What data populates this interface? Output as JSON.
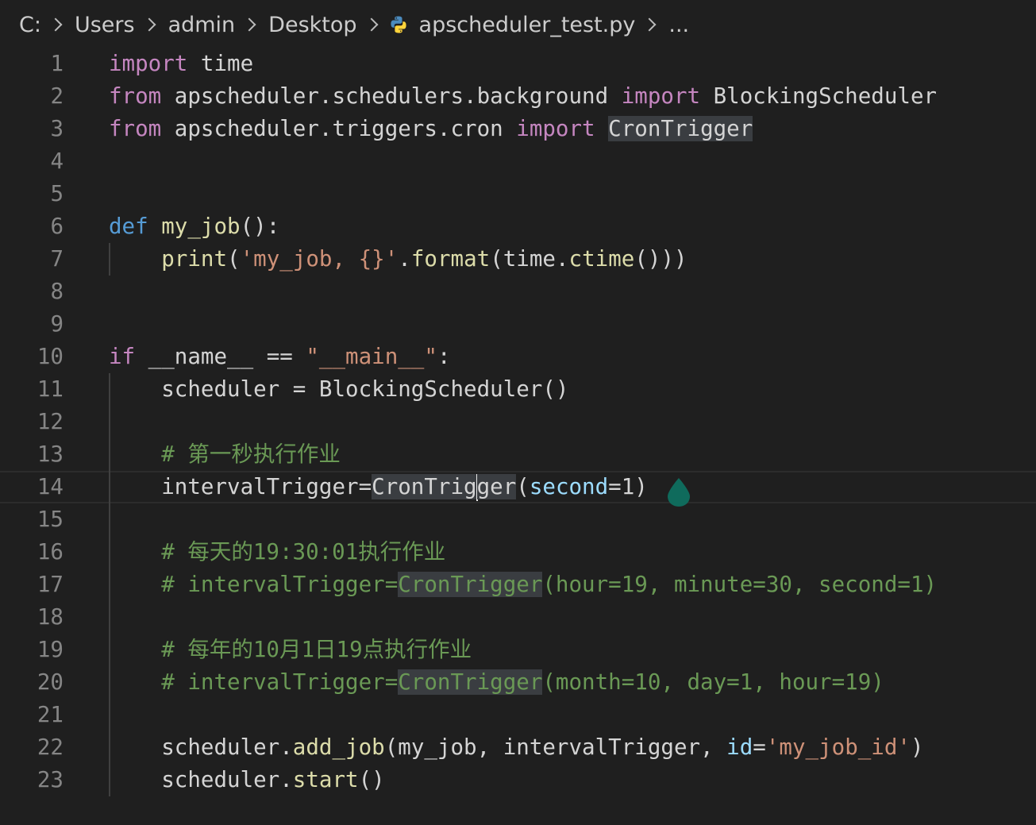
{
  "breadcrumb": {
    "items": [
      "C:",
      "Users",
      "admin",
      "Desktop",
      "apscheduler_test.py",
      "..."
    ]
  },
  "editor": {
    "language": "python",
    "file_icon": "python-file-icon",
    "current_line": 14,
    "lines": [
      {
        "num": "1",
        "tokens": [
          {
            "t": "import",
            "c": "kw-import"
          },
          {
            "t": " time",
            "c": ""
          }
        ]
      },
      {
        "num": "2",
        "tokens": [
          {
            "t": "from",
            "c": "kw-import"
          },
          {
            "t": " apscheduler.schedulers.background ",
            "c": ""
          },
          {
            "t": "import",
            "c": "kw-import"
          },
          {
            "t": " BlockingScheduler",
            "c": ""
          }
        ]
      },
      {
        "num": "3",
        "tokens": [
          {
            "t": "from",
            "c": "kw-import"
          },
          {
            "t": " apscheduler.triggers.cron ",
            "c": ""
          },
          {
            "t": "import",
            "c": "kw-import"
          },
          {
            "t": " ",
            "c": ""
          },
          {
            "t": "CronTrigger",
            "c": "hl"
          }
        ]
      },
      {
        "num": "4",
        "tokens": []
      },
      {
        "num": "5",
        "tokens": []
      },
      {
        "num": "6",
        "tokens": [
          {
            "t": "def",
            "c": "kw-def"
          },
          {
            "t": " ",
            "c": ""
          },
          {
            "t": "my_job",
            "c": "fn"
          },
          {
            "t": "():",
            "c": ""
          }
        ]
      },
      {
        "num": "7",
        "tokens": [
          {
            "t": "    ",
            "c": ""
          },
          {
            "t": "print",
            "c": "fn"
          },
          {
            "t": "(",
            "c": ""
          },
          {
            "t": "'my_job, {}'",
            "c": "str"
          },
          {
            "t": ".",
            "c": ""
          },
          {
            "t": "format",
            "c": "fn"
          },
          {
            "t": "(time.",
            "c": ""
          },
          {
            "t": "ctime",
            "c": "fn"
          },
          {
            "t": "()))",
            "c": ""
          }
        ]
      },
      {
        "num": "8",
        "tokens": []
      },
      {
        "num": "9",
        "tokens": []
      },
      {
        "num": "10",
        "tokens": [
          {
            "t": "if",
            "c": "kw-import"
          },
          {
            "t": " __name__ == ",
            "c": ""
          },
          {
            "t": "\"__main__\"",
            "c": "str"
          },
          {
            "t": ":",
            "c": ""
          }
        ]
      },
      {
        "num": "11",
        "tokens": [
          {
            "t": "    scheduler = BlockingScheduler()",
            "c": ""
          }
        ]
      },
      {
        "num": "12",
        "tokens": []
      },
      {
        "num": "13",
        "tokens": [
          {
            "t": "    ",
            "c": ""
          },
          {
            "t": "# 第一秒执行作业",
            "c": "cmt"
          }
        ]
      },
      {
        "num": "14",
        "tokens": [
          {
            "t": "    intervalTrigger=",
            "c": ""
          },
          {
            "t": "CronTrig",
            "c": "hl"
          },
          {
            "t": "|",
            "c": "cursor"
          },
          {
            "t": "ger",
            "c": "hl"
          },
          {
            "t": "(",
            "c": ""
          },
          {
            "t": "second",
            "c": "param"
          },
          {
            "t": "=1)",
            "c": ""
          }
        ]
      },
      {
        "num": "15",
        "tokens": []
      },
      {
        "num": "16",
        "tokens": [
          {
            "t": "    ",
            "c": ""
          },
          {
            "t": "# 每天的19:30:01执行作业",
            "c": "cmt"
          }
        ]
      },
      {
        "num": "17",
        "tokens": [
          {
            "t": "    ",
            "c": ""
          },
          {
            "t": "# intervalTrigger=",
            "c": "cmt"
          },
          {
            "t": "CronTrigger",
            "c": "cmt hl"
          },
          {
            "t": "(hour=19, minute=30, second=1)",
            "c": "cmt"
          }
        ]
      },
      {
        "num": "18",
        "tokens": []
      },
      {
        "num": "19",
        "tokens": [
          {
            "t": "    ",
            "c": ""
          },
          {
            "t": "# 每年的10月1日19点执行作业",
            "c": "cmt"
          }
        ]
      },
      {
        "num": "20",
        "tokens": [
          {
            "t": "    ",
            "c": ""
          },
          {
            "t": "# intervalTrigger=",
            "c": "cmt"
          },
          {
            "t": "CronTrigger",
            "c": "cmt hl"
          },
          {
            "t": "(month=10, day=1, hour=19)",
            "c": "cmt"
          }
        ]
      },
      {
        "num": "21",
        "tokens": []
      },
      {
        "num": "22",
        "tokens": [
          {
            "t": "    scheduler.",
            "c": ""
          },
          {
            "t": "add_job",
            "c": "fn"
          },
          {
            "t": "(my_job, intervalTrigger, ",
            "c": ""
          },
          {
            "t": "id",
            "c": "param"
          },
          {
            "t": "=",
            "c": ""
          },
          {
            "t": "'my_job_id'",
            "c": "str"
          },
          {
            "t": ")",
            "c": ""
          }
        ]
      },
      {
        "num": "23",
        "tokens": [
          {
            "t": "    scheduler.",
            "c": ""
          },
          {
            "t": "start",
            "c": "fn"
          },
          {
            "t": "()",
            "c": ""
          }
        ]
      }
    ]
  }
}
